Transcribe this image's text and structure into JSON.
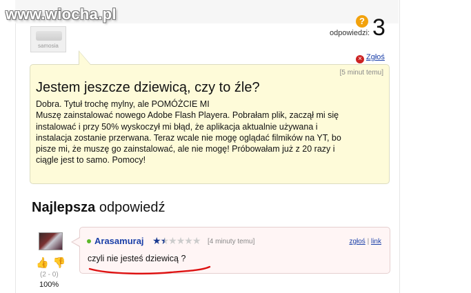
{
  "watermark": "www.wiocha.pl",
  "header": {
    "avatar_text": "samosia",
    "answers_label": "odpowiedzi:",
    "answers_count": "3",
    "question_icon": "?",
    "report_label": "Zgłoś"
  },
  "question": {
    "time": "[5 minut temu]",
    "title": "Jestem jeszcze dziewicą, czy to źle?",
    "body": [
      "Dobra. Tytuł trochę mylny, ale POMÓŻCIE MI",
      "Muszę zainstalować nowego Adobe Flash Playera. Pobrałam plik, zaczął mi się",
      "instalować i przy 50% wyskoczył mi błąd, że aplikacja aktualnie używana i",
      "instalacja zostanie przerwana. Teraz wcale nie mogę oglądać filmików na YT, bo",
      "pisze mi, że muszę go zainstalować, ale nie mogę! Próbowałam już z 20 razy i",
      "ciągle jest to samo. Pomocy!"
    ]
  },
  "best_answer": {
    "heading_bold": "Najlepsza",
    "heading_rest": "odpowiedź",
    "user": "Arasamuraj",
    "rating_stars": 1.5,
    "rating_max": 6,
    "time": "[4 minuty temu]",
    "report_link": "zgłoś",
    "separator": "|",
    "link_label": "link",
    "text": "czyli nie jesteś dziewicą ?",
    "votes": "(2 - 0)",
    "percent": "100%"
  },
  "colors": {
    "question_bg": "#fefbd9",
    "answer_bg": "#fff5f5",
    "link": "#1a3fa8",
    "underline": "#dd1111"
  }
}
